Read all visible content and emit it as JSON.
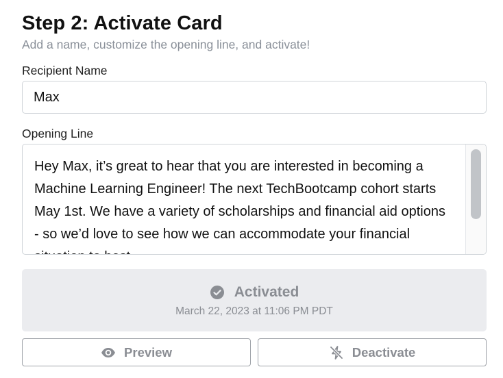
{
  "header": {
    "title": "Step 2: Activate Card",
    "subtitle": "Add a name, customize the opening line, and activate!"
  },
  "recipient": {
    "label": "Recipient Name",
    "value": "Max"
  },
  "opening_line": {
    "label": "Opening Line",
    "value": "Hey Max, it’s great to hear that you are interested in becoming a Machine Learning Engineer! The next TechBootcamp cohort starts May 1st. We have a variety of scholarships and financial aid options - so we’d love to see how we can accommodate your financial situation to best"
  },
  "status": {
    "label": "Activated",
    "date": "March 22, 2023 at 11:06 PM PDT",
    "icon": "check-circle-icon",
    "color": "#8a8d93",
    "panel_color": "#ebecef"
  },
  "actions": {
    "preview_label": "Preview",
    "preview_icon": "eye-icon",
    "deactivate_label": "Deactivate",
    "deactivate_icon": "zap-off-icon"
  }
}
